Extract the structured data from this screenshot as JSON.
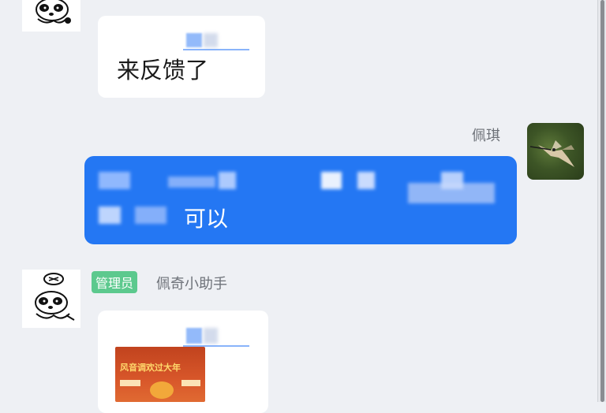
{
  "messages": [
    {
      "text": "来反馈了"
    },
    {
      "sender": "佩琪",
      "text": "可以"
    },
    {
      "badge": "管理员",
      "sender": "佩奇小助手",
      "poster_title": "风音调欢过大年"
    }
  ],
  "colors": {
    "blue_bubble": "#2477f3",
    "admin_badge": "#5cc98e",
    "background": "#eef0f4"
  }
}
